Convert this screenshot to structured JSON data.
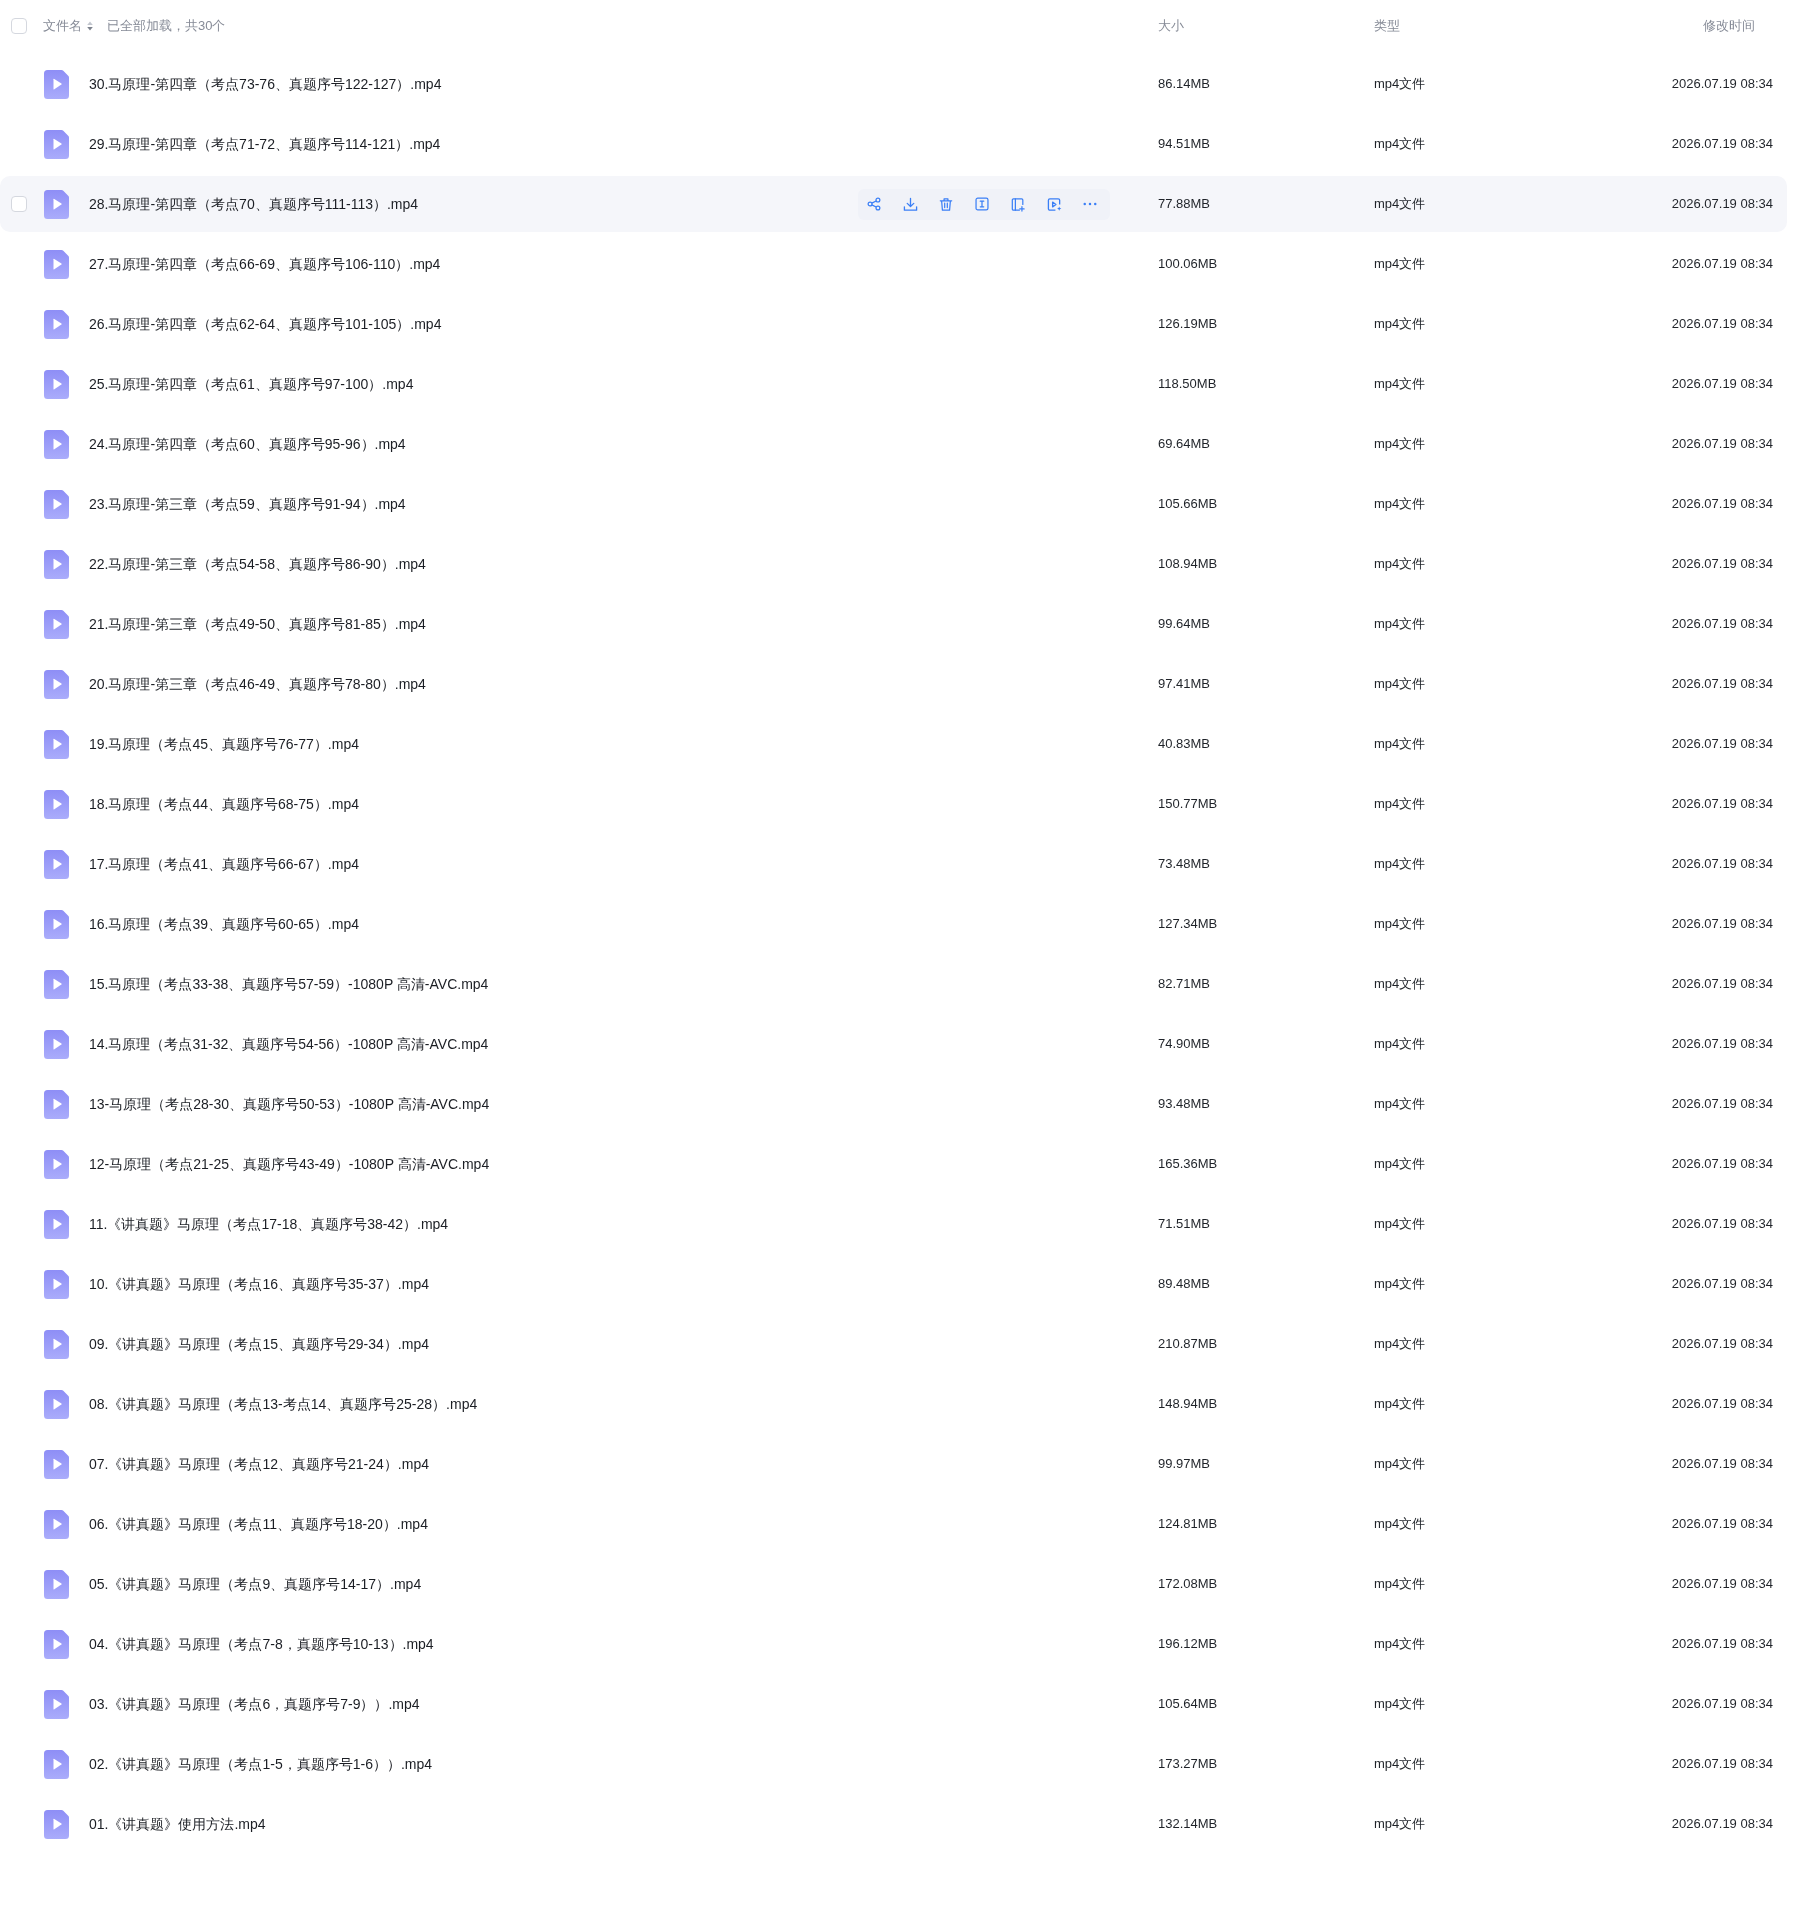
{
  "header": {
    "select_all": {
      "checked": false
    },
    "name_label": "文件名",
    "summary": "已全部加载，共30个",
    "size_label": "大小",
    "type_label": "类型",
    "modified_label": "修改时间"
  },
  "rows": [
    {
      "name": "30.马原理-第四章（考点73-76、真题序号122-127）.mp4",
      "size": "86.14MB",
      "type": "mp4文件",
      "modified": "2026.07.19 08:34",
      "hovered": false,
      "checked": false
    },
    {
      "name": "29.马原理-第四章（考点71-72、真题序号114-121）.mp4",
      "size": "94.51MB",
      "type": "mp4文件",
      "modified": "2026.07.19 08:34",
      "hovered": false,
      "checked": false
    },
    {
      "name": "28.马原理-第四章（考点70、真题序号111-113）.mp4",
      "size": "77.88MB",
      "type": "mp4文件",
      "modified": "2026.07.19 08:34",
      "hovered": true,
      "checked": false
    },
    {
      "name": "27.马原理-第四章（考点66-69、真题序号106-110）.mp4",
      "size": "100.06MB",
      "type": "mp4文件",
      "modified": "2026.07.19 08:34",
      "hovered": false,
      "checked": false
    },
    {
      "name": "26.马原理-第四章（考点62-64、真题序号101-105）.mp4",
      "size": "126.19MB",
      "type": "mp4文件",
      "modified": "2026.07.19 08:34",
      "hovered": false,
      "checked": false
    },
    {
      "name": "25.马原理-第四章（考点61、真题序号97-100）.mp4",
      "size": "118.50MB",
      "type": "mp4文件",
      "modified": "2026.07.19 08:34",
      "hovered": false,
      "checked": false
    },
    {
      "name": "24.马原理-第四章（考点60、真题序号95-96）.mp4",
      "size": "69.64MB",
      "type": "mp4文件",
      "modified": "2026.07.19 08:34",
      "hovered": false,
      "checked": false
    },
    {
      "name": "23.马原理-第三章（考点59、真题序号91-94）.mp4",
      "size": "105.66MB",
      "type": "mp4文件",
      "modified": "2026.07.19 08:34",
      "hovered": false,
      "checked": false
    },
    {
      "name": "22.马原理-第三章（考点54-58、真题序号86-90）.mp4",
      "size": "108.94MB",
      "type": "mp4文件",
      "modified": "2026.07.19 08:34",
      "hovered": false,
      "checked": false
    },
    {
      "name": "21.马原理-第三章（考点49-50、真题序号81-85）.mp4",
      "size": "99.64MB",
      "type": "mp4文件",
      "modified": "2026.07.19 08:34",
      "hovered": false,
      "checked": false
    },
    {
      "name": "20.马原理-第三章（考点46-49、真题序号78-80）.mp4",
      "size": "97.41MB",
      "type": "mp4文件",
      "modified": "2026.07.19 08:34",
      "hovered": false,
      "checked": false
    },
    {
      "name": "19.马原理（考点45、真题序号76-77）.mp4",
      "size": "40.83MB",
      "type": "mp4文件",
      "modified": "2026.07.19 08:34",
      "hovered": false,
      "checked": false
    },
    {
      "name": "18.马原理（考点44、真题序号68-75）.mp4",
      "size": "150.77MB",
      "type": "mp4文件",
      "modified": "2026.07.19 08:34",
      "hovered": false,
      "checked": false
    },
    {
      "name": "17.马原理（考点41、真题序号66-67）.mp4",
      "size": "73.48MB",
      "type": "mp4文件",
      "modified": "2026.07.19 08:34",
      "hovered": false,
      "checked": false
    },
    {
      "name": "16.马原理（考点39、真题序号60-65）.mp4",
      "size": "127.34MB",
      "type": "mp4文件",
      "modified": "2026.07.19 08:34",
      "hovered": false,
      "checked": false
    },
    {
      "name": "15.马原理（考点33-38、真题序号57-59）-1080P 高清-AVC.mp4",
      "size": "82.71MB",
      "type": "mp4文件",
      "modified": "2026.07.19 08:34",
      "hovered": false,
      "checked": false
    },
    {
      "name": "14.马原理（考点31-32、真题序号54-56）-1080P 高清-AVC.mp4",
      "size": "74.90MB",
      "type": "mp4文件",
      "modified": "2026.07.19 08:34",
      "hovered": false,
      "checked": false
    },
    {
      "name": "13-马原理（考点28-30、真题序号50-53）-1080P 高清-AVC.mp4",
      "size": "93.48MB",
      "type": "mp4文件",
      "modified": "2026.07.19 08:34",
      "hovered": false,
      "checked": false
    },
    {
      "name": "12-马原理（考点21-25、真题序号43-49）-1080P 高清-AVC.mp4",
      "size": "165.36MB",
      "type": "mp4文件",
      "modified": "2026.07.19 08:34",
      "hovered": false,
      "checked": false
    },
    {
      "name": "11.《讲真题》马原理（考点17-18、真题序号38-42）.mp4",
      "size": "71.51MB",
      "type": "mp4文件",
      "modified": "2026.07.19 08:34",
      "hovered": false,
      "checked": false
    },
    {
      "name": "10.《讲真题》马原理（考点16、真题序号35-37）.mp4",
      "size": "89.48MB",
      "type": "mp4文件",
      "modified": "2026.07.19 08:34",
      "hovered": false,
      "checked": false
    },
    {
      "name": "09.《讲真题》马原理（考点15、真题序号29-34）.mp4",
      "size": "210.87MB",
      "type": "mp4文件",
      "modified": "2026.07.19 08:34",
      "hovered": false,
      "checked": false
    },
    {
      "name": "08.《讲真题》马原理（考点13-考点14、真题序号25-28）.mp4",
      "size": "148.94MB",
      "type": "mp4文件",
      "modified": "2026.07.19 08:34",
      "hovered": false,
      "checked": false
    },
    {
      "name": "07.《讲真题》马原理（考点12、真题序号21-24）.mp4",
      "size": "99.97MB",
      "type": "mp4文件",
      "modified": "2026.07.19 08:34",
      "hovered": false,
      "checked": false
    },
    {
      "name": "06.《讲真题》马原理（考点11、真题序号18-20）.mp4",
      "size": "124.81MB",
      "type": "mp4文件",
      "modified": "2026.07.19 08:34",
      "hovered": false,
      "checked": false
    },
    {
      "name": "05.《讲真题》马原理（考点9、真题序号14-17）.mp4",
      "size": "172.08MB",
      "type": "mp4文件",
      "modified": "2026.07.19 08:34",
      "hovered": false,
      "checked": false
    },
    {
      "name": "04.《讲真题》马原理（考点7-8，真题序号10-13）.mp4",
      "size": "196.12MB",
      "type": "mp4文件",
      "modified": "2026.07.19 08:34",
      "hovered": false,
      "checked": false
    },
    {
      "name": "03.《讲真题》马原理（考点6，真题序号7-9））.mp4",
      "size": "105.64MB",
      "type": "mp4文件",
      "modified": "2026.07.19 08:34",
      "hovered": false,
      "checked": false
    },
    {
      "name": "02.《讲真题》马原理（考点1-5，真题序号1-6））.mp4",
      "size": "173.27MB",
      "type": "mp4文件",
      "modified": "2026.07.19 08:34",
      "hovered": false,
      "checked": false
    },
    {
      "name": "01.《讲真题》使用方法.mp4",
      "size": "132.14MB",
      "type": "mp4文件",
      "modified": "2026.07.19 08:34",
      "hovered": false,
      "checked": false
    }
  ]
}
